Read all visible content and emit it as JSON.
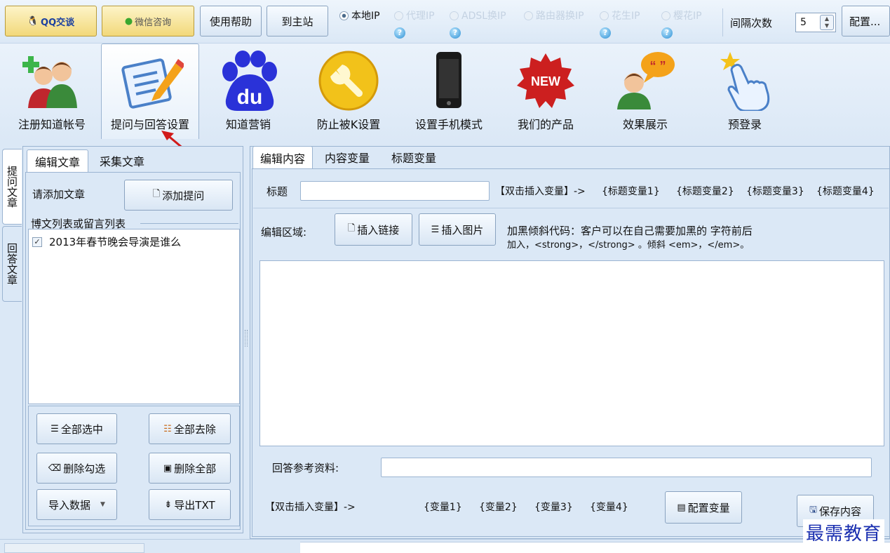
{
  "top": {
    "qq_label": "QQ交谈",
    "wechat_label": "微信咨询",
    "help_label": "使用帮助",
    "home_label": "到主站",
    "radios": [
      "本地IP",
      "代理IP",
      "ADSL换IP",
      "路由器换IP",
      "花生IP",
      "樱花IP"
    ],
    "interval_label": "间隔次数",
    "interval_value": "5",
    "config_label": "配置..."
  },
  "tools": [
    "注册知道帐号",
    "提问与回答设置",
    "知道营销",
    "防止被K设置",
    "设置手机模式",
    "我们的产品",
    "效果展示",
    "预登录"
  ],
  "new_badge": "NEW",
  "baidu_text": "du",
  "left": {
    "vtabs": [
      "提问文章",
      "回答文章"
    ],
    "tabs": [
      "编辑文章",
      "采集文章"
    ],
    "add_label": "请添加文章",
    "add_button": "添加提问",
    "group_title": "博文列表或留言列表",
    "articles": [
      {
        "title": "2013年春节晚会导演是谁么",
        "checked": true
      }
    ],
    "buttons": {
      "select_all": "全部选中",
      "remove_all": "全部去除",
      "delete_checked": "删除勾选",
      "delete_all": "删除全部",
      "import": "导入数据",
      "export": "导出TXT"
    }
  },
  "right": {
    "tabs": [
      "编辑内容",
      "内容变量",
      "标题变量"
    ],
    "title_label": "标题",
    "title_value": "",
    "title_hint": "【双击插入变量】->",
    "title_vars": [
      "{标题变量1}",
      "{标题变量2}",
      "{标题变量3}",
      "{标题变量4}"
    ],
    "edit_label": "编辑区域:",
    "insert_link": "插入链接",
    "insert_image": "插入图片",
    "bold_hint_1": "加黑倾斜代码：客户可以在自己需要加黑的 字符前后",
    "bold_hint_2": "加入，<strong>，</strong> 。倾斜 <em>，</em>。",
    "answer_ref_label": "回答参考资料:",
    "answer_ref_value": "",
    "vars_hint": "【双击插入变量】->",
    "content_vars": [
      "{变量1}",
      "{变量2}",
      "{变量3}",
      "{变量4}"
    ],
    "config_vars": "配置变量",
    "save": "保存内容"
  },
  "watermark": "最需教育"
}
